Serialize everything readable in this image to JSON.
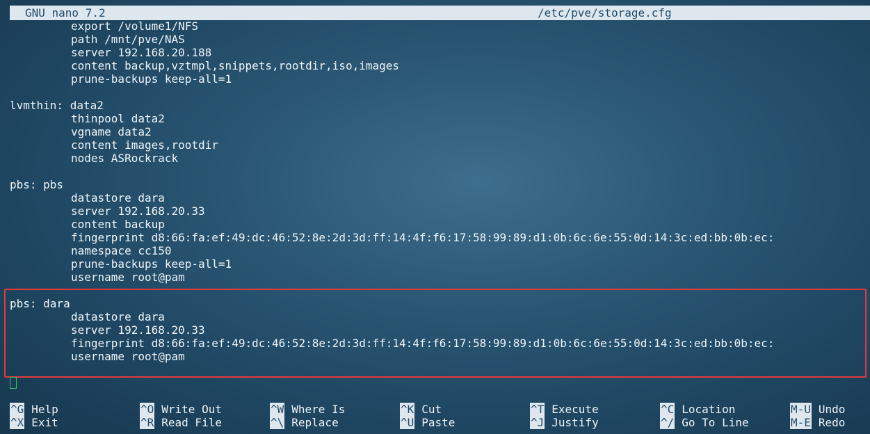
{
  "titlebar": {
    "app": "GNU nano 7.2",
    "file": "/etc/pve/storage.cfg"
  },
  "editor": {
    "lines": [
      {
        "text": "export /volume1/NFS",
        "indent": true
      },
      {
        "text": "path /mnt/pve/NAS",
        "indent": true
      },
      {
        "text": "server 192.168.20.188",
        "indent": true
      },
      {
        "text": "content backup,vztmpl,snippets,rootdir,iso,images",
        "indent": true
      },
      {
        "text": "prune-backups keep-all=1",
        "indent": true
      },
      {
        "text": "",
        "indent": false
      },
      {
        "text": "lvmthin: data2",
        "indent": false
      },
      {
        "text": "thinpool data2",
        "indent": true
      },
      {
        "text": "vgname data2",
        "indent": true
      },
      {
        "text": "content images,rootdir",
        "indent": true
      },
      {
        "text": "nodes ASRockrack",
        "indent": true
      },
      {
        "text": "",
        "indent": false
      },
      {
        "text": "pbs: pbs",
        "indent": false
      },
      {
        "text": "datastore dara",
        "indent": true
      },
      {
        "text": "server 192.168.20.33",
        "indent": true
      },
      {
        "text": "content backup",
        "indent": true
      },
      {
        "text": "fingerprint d8:66:fa:ef:49:dc:46:52:8e:2d:3d:ff:14:4f:f6:17:58:99:89:d1:0b:6c:6e:55:0d:14:3c:ed:bb:0b:ec:",
        "indent": true
      },
      {
        "text": "namespace cc150",
        "indent": true
      },
      {
        "text": "prune-backups keep-all=1",
        "indent": true
      },
      {
        "text": "username root@pam",
        "indent": true
      },
      {
        "text": "",
        "indent": false
      },
      {
        "text": "pbs: dara",
        "indent": false
      },
      {
        "text": "datastore dara",
        "indent": true
      },
      {
        "text": "server 192.168.20.33",
        "indent": true
      },
      {
        "text": "fingerprint d8:66:fa:ef:49:dc:46:52:8e:2d:3d:ff:14:4f:f6:17:58:99:89:d1:0b:6c:6e:55:0d:14:3c:ed:bb:0b:ec:",
        "indent": true
      },
      {
        "text": "username root@pam",
        "indent": true
      }
    ]
  },
  "shortcuts": [
    {
      "key": "^G",
      "label": "Help"
    },
    {
      "key": "^O",
      "label": "Write Out"
    },
    {
      "key": "^W",
      "label": "Where Is"
    },
    {
      "key": "^K",
      "label": "Cut"
    },
    {
      "key": "^T",
      "label": "Execute"
    },
    {
      "key": "^C",
      "label": "Location"
    },
    {
      "key": "M-U",
      "label": "Undo"
    },
    {
      "key": "^X",
      "label": "Exit"
    },
    {
      "key": "^R",
      "label": "Read File"
    },
    {
      "key": "^\\",
      "label": "Replace"
    },
    {
      "key": "^U",
      "label": "Paste"
    },
    {
      "key": "^J",
      "label": "Justify"
    },
    {
      "key": "^/",
      "label": "Go To Line"
    },
    {
      "key": "M-E",
      "label": "Redo"
    }
  ],
  "colors": {
    "highlight_border": "#e23a3a",
    "cursor": "#39c265",
    "bar_background": "#dfe7ee"
  }
}
